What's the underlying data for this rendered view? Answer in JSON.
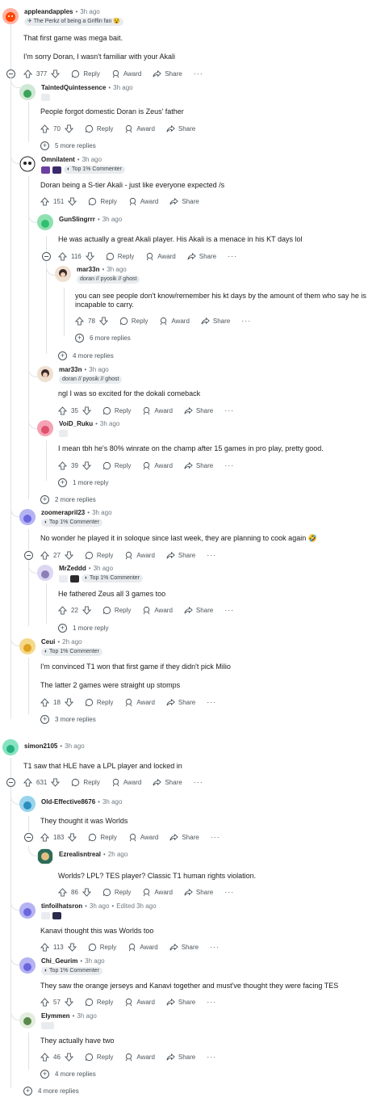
{
  "labels": {
    "reply": "Reply",
    "award": "Award",
    "share": "Share"
  },
  "threads": [
    {
      "author": "appleandapples",
      "time": "3h ago",
      "flair": "The Perkz of being a Griffin fan",
      "body": [
        "That first game was mega bait.",
        "I'm sorry Doran, I wasn't familiar with your Akali"
      ],
      "score": "377",
      "replies": [
        {
          "author": "TaintedQuintessence",
          "time": "3h ago",
          "body": [
            "People forgot domestic Doran is Zeus' father"
          ],
          "score": "70",
          "more": "5 more replies"
        },
        {
          "author": "Omnilatent",
          "time": "3h ago",
          "flair": "Top 1% Commenter",
          "body": [
            "Doran being a S-tier Akali - just like everyone expected /s"
          ],
          "score": "151",
          "replies": [
            {
              "author": "GunSlingrrr",
              "time": "3h ago",
              "body": [
                "He was actually a great Akali player. His Akali is a menace in his KT days lol"
              ],
              "score": "116",
              "replies": [
                {
                  "author": "mar33n",
                  "time": "3h ago",
                  "flair": "doran // pyosik // ghost",
                  "body": [
                    "you can see people don't know/remember his kt days by the amount of them who say he is incapable to carry."
                  ],
                  "score": "78",
                  "more": "6 more replies"
                }
              ],
              "more": "4 more replies"
            },
            {
              "author": "mar33n",
              "time": "3h ago",
              "flair": "doran // pyosik // ghost",
              "body": [
                "ngl I was so excited for the dokali comeback"
              ],
              "score": "35"
            },
            {
              "author": "VoiD_Ruku",
              "time": "3h ago",
              "body": [
                "I mean tbh he's 80% winrate on the champ after 15 games in pro play, pretty good."
              ],
              "score": "39",
              "more": "1 more reply"
            }
          ],
          "more": "2 more replies"
        },
        {
          "author": "zoomerapril23",
          "time": "3h ago",
          "flair": "Top 1% Commenter",
          "body": [
            "No wonder he played it in soloque since last week, they are planning to cook again 🤣"
          ],
          "score": "27",
          "replies": [
            {
              "author": "MrZeddd",
              "time": "3h ago",
              "flair": "Top 1% Commenter",
              "body": [
                "He fathered Zeus all 3 games too"
              ],
              "score": "22",
              "more": "1 more reply"
            }
          ]
        },
        {
          "author": "Ceui",
          "time": "2h ago",
          "flair": "Top 1% Commenter",
          "body": [
            "I'm convinced T1 won that first game if they didn't pick Milio",
            "The latter 2 games were straight up stomps"
          ],
          "score": "18",
          "more": "3 more replies"
        }
      ]
    },
    {
      "author": "simon2105",
      "time": "3h ago",
      "body": [
        "T1 saw that HLE have a LPL player and locked in"
      ],
      "score": "631",
      "replies": [
        {
          "author": "Old-Effective8676",
          "time": "3h ago",
          "body": [
            "They thought it was Worlds"
          ],
          "score": "183",
          "replies": [
            {
              "author": "Ezrealisntreal",
              "time": "2h ago",
              "body": [
                "Worlds? LPL? TES player? Classic T1 human rights violation."
              ],
              "score": "86"
            }
          ]
        },
        {
          "author": "tinfoilhatsron",
          "time": "3h ago",
          "edited": "Edited 3h ago",
          "body": [
            "Kanavi thought this was Worlds too"
          ],
          "score": "113"
        },
        {
          "author": "Chi_Geurim",
          "time": "3h ago",
          "flair": "Top 1% Commenter",
          "body": [
            "They saw the orange jerseys and Kanavi together and must've thought they were facing TES"
          ],
          "score": "57"
        },
        {
          "author": "Elymmen",
          "time": "3h ago",
          "body": [
            "They actually have two"
          ],
          "score": "46",
          "more": "4 more replies"
        }
      ],
      "more": "4 more replies"
    }
  ],
  "colors": {
    "accent": "#0079d3",
    "meta": "#6f7a82",
    "line": "#dfe3e6"
  }
}
